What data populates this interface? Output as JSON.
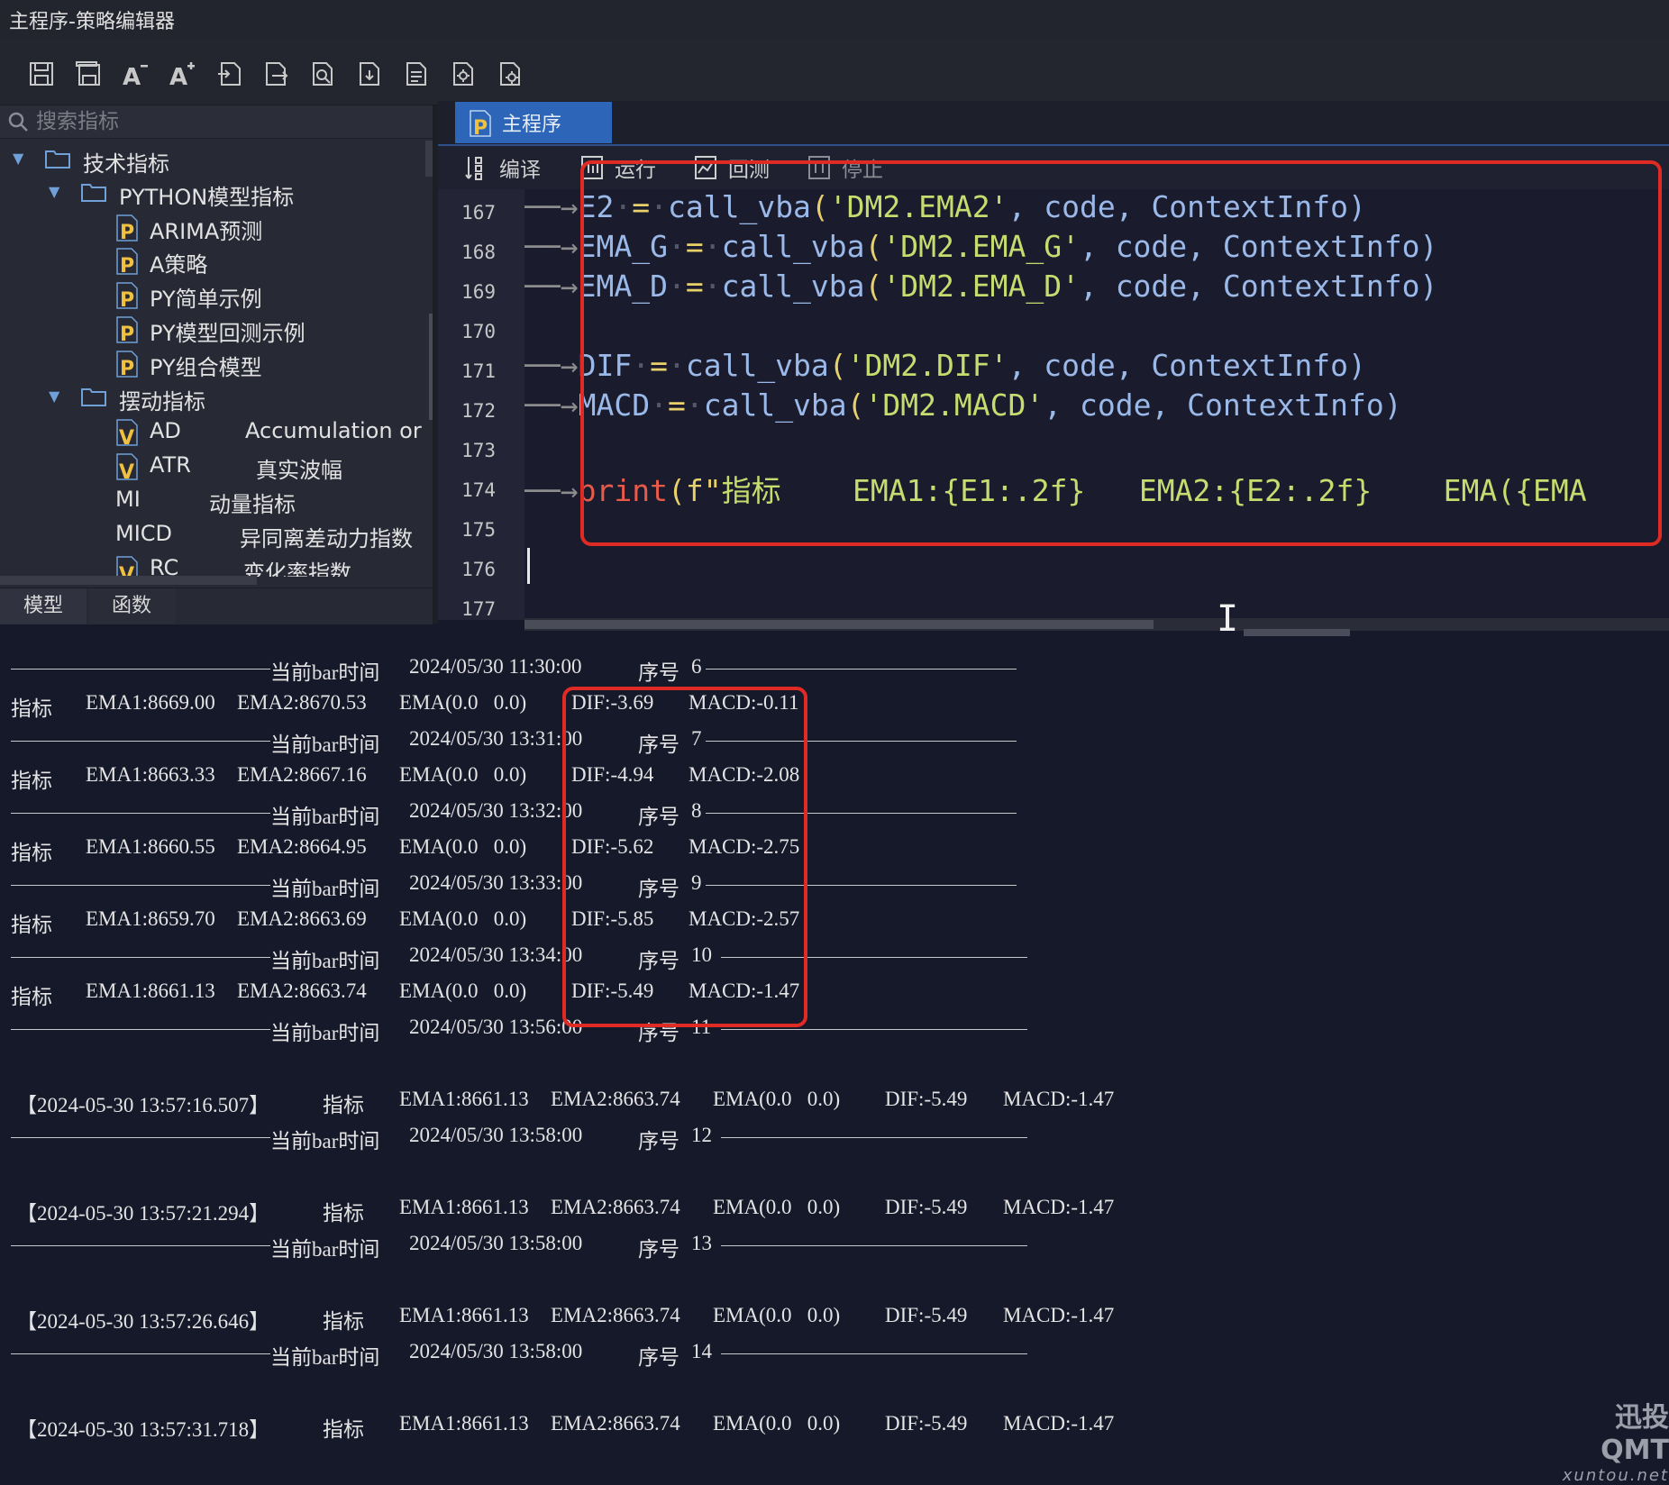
{
  "window": {
    "title": "主程序-策略编辑器"
  },
  "toolbar": {
    "buttons": [
      {
        "icon": "save-icon"
      },
      {
        "icon": "save-all-icon"
      },
      {
        "icon": "font-decrease-icon",
        "label": "A-"
      },
      {
        "icon": "font-increase-icon",
        "label": "A+"
      },
      {
        "icon": "import-icon"
      },
      {
        "icon": "export-icon"
      },
      {
        "icon": "find-icon"
      },
      {
        "icon": "download-icon"
      },
      {
        "icon": "document-icon"
      },
      {
        "icon": "settings-icon"
      },
      {
        "icon": "settings-alt-icon"
      }
    ]
  },
  "sidebar": {
    "search_placeholder": "搜索指标",
    "tree": {
      "root": "技术指标",
      "python_folder": "PYTHON模型指标",
      "python_items": [
        "ARIMA预测",
        "A策略",
        "PY简单示例",
        "PY模型回测示例",
        "PY组合模型"
      ],
      "swing_folder": "摆动指标",
      "swing_items": [
        {
          "type": "V",
          "name": "AD",
          "desc": "Accumulation or"
        },
        {
          "type": "V",
          "name": "ATR",
          "desc": "真实波幅"
        },
        {
          "type": "",
          "name": "MI",
          "desc": "动量指标"
        },
        {
          "type": "",
          "name": "MICD",
          "desc": "异同离差动力指数"
        },
        {
          "type": "V",
          "name": "RC",
          "desc": "变化率指数"
        }
      ]
    },
    "tabs": [
      "模型",
      "函数"
    ]
  },
  "editor": {
    "tab_label": "主程序",
    "tab_icon": "P",
    "actions": [
      "编译",
      "运行",
      "回测",
      "停止"
    ],
    "line_numbers": [
      "167",
      "168",
      "169",
      "170",
      "171",
      "172",
      "173",
      "174",
      "175",
      "176",
      "177"
    ],
    "lines": [
      {
        "var": "E2",
        "fn": "call_vba",
        "arg": "'DM2.EMA2'",
        "rest": ", code, ContextInfo)"
      },
      {
        "var": "EMA_G",
        "fn": "call_vba",
        "arg": "'DM2.EMA_G'",
        "rest": ", code, ContextInfo)"
      },
      {
        "var": "EMA_D",
        "fn": "call_vba",
        "arg": "'DM2.EMA_D'",
        "rest": ", code, ContextInfo)"
      },
      {
        "blank": true
      },
      {
        "var": "DIF",
        "fn": "call_vba",
        "arg": "'DM2.DIF'",
        "rest": ", code, ContextInfo)"
      },
      {
        "var": "MACD",
        "fn": "call_vba",
        "arg": "'DM2.MACD'",
        "rest": ", code, ContextInfo)"
      },
      {
        "blank": true
      },
      {
        "print": "print",
        "paren": "(f\"",
        "text": "指标    EMA1:{E1:.2f}   EMA2:{E2:.2f}    EMA({EMA"
      },
      {
        "blank": true
      },
      {
        "blank": true
      },
      {
        "blank": true
      }
    ]
  },
  "output": {
    "bar_label": "当前bar时间",
    "seq_label": "序号",
    "indicator_label": "指标",
    "bars": [
      {
        "time": "2024/05/30 11:30:00",
        "seq": "6"
      },
      {
        "time": "2024/05/30 13:31:00",
        "seq": "7"
      },
      {
        "time": "2024/05/30 13:32:00",
        "seq": "8"
      },
      {
        "time": "2024/05/30 13:33:00",
        "seq": "9"
      },
      {
        "time": "2024/05/30 13:34:00",
        "seq": "10"
      },
      {
        "time": "2024/05/30 13:56:00",
        "seq": "11"
      },
      {
        "time": "2024/05/30 13:58:00",
        "seq": "12"
      },
      {
        "time": "2024/05/30 13:58:00",
        "seq": "13"
      },
      {
        "time": "2024/05/30 13:58:00",
        "seq": "14"
      }
    ],
    "indicators": [
      {
        "ema1": "EMA1:8669.00",
        "ema2": "EMA2:8670.53",
        "ema": "EMA(0.0   0.0)",
        "dif": "DIF:-3.69",
        "macd": "MACD:-0.11"
      },
      {
        "ema1": "EMA1:8663.33",
        "ema2": "EMA2:8667.16",
        "ema": "EMA(0.0   0.0)",
        "dif": "DIF:-4.94",
        "macd": "MACD:-2.08"
      },
      {
        "ema1": "EMA1:8660.55",
        "ema2": "EMA2:8664.95",
        "ema": "EMA(0.0   0.0)",
        "dif": "DIF:-5.62",
        "macd": "MACD:-2.75"
      },
      {
        "ema1": "EMA1:8659.70",
        "ema2": "EMA2:8663.69",
        "ema": "EMA(0.0   0.0)",
        "dif": "DIF:-5.85",
        "macd": "MACD:-2.57"
      },
      {
        "ema1": "EMA1:8661.13",
        "ema2": "EMA2:8663.74",
        "ema": "EMA(0.0   0.0)",
        "dif": "DIF:-5.49",
        "macd": "MACD:-1.47"
      }
    ],
    "timestamped": [
      {
        "ts": "【2024-05-30 13:57:16.507】",
        "ema1": "EMA1:8661.13",
        "ema2": "EMA2:8663.74",
        "ema": "EMA(0.0   0.0)",
        "dif": "DIF:-5.49",
        "macd": "MACD:-1.47"
      },
      {
        "ts": "【2024-05-30 13:57:21.294】",
        "ema1": "EMA1:8661.13",
        "ema2": "EMA2:8663.74",
        "ema": "EMA(0.0   0.0)",
        "dif": "DIF:-5.49",
        "macd": "MACD:-1.47"
      },
      {
        "ts": "【2024-05-30 13:57:26.646】",
        "ema1": "EMA1:8661.13",
        "ema2": "EMA2:8663.74",
        "ema": "EMA(0.0   0.0)",
        "dif": "DIF:-5.49",
        "macd": "MACD:-1.47"
      },
      {
        "ts": "【2024-05-30 13:57:31.718】",
        "ema1": "EMA1:8661.13",
        "ema2": "EMA2:8663.74",
        "ema": "EMA(0.0   0.0)",
        "dif": "DIF:-5.49",
        "macd": "MACD:-1.47"
      }
    ]
  },
  "watermark": {
    "brand": "迅投QMT",
    "site": "xuntou.net"
  },
  "colors": {
    "highlight_box": "#e02a24",
    "tab_active": "#2d66b8",
    "string": "#c6dc6e",
    "keyword": "#e85a4a"
  }
}
